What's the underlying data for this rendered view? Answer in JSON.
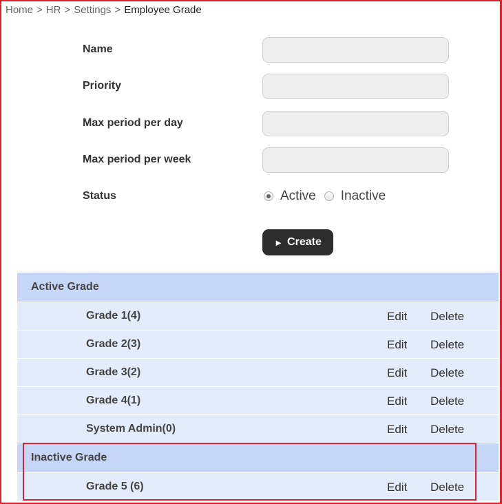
{
  "breadcrumb": {
    "items": [
      "Home",
      "HR",
      "Settings"
    ],
    "separator": ">",
    "current": "Employee Grade"
  },
  "form": {
    "name_label": "Name",
    "priority_label": "Priority",
    "max_day_label": "Max period per day",
    "max_week_label": "Max period per week",
    "status_label": "Status",
    "name_value": "",
    "priority_value": "",
    "max_day_value": "",
    "max_week_value": "",
    "status_options": [
      "Active",
      "Inactive"
    ],
    "status_selected": "Active",
    "create_label": "Create",
    "create_icon": "play-icon"
  },
  "active_grades": {
    "header": "Active Grade",
    "rows": [
      {
        "name": "Grade 1(4)",
        "edit": "Edit",
        "delete": "Delete"
      },
      {
        "name": "Grade 2(3)",
        "edit": "Edit",
        "delete": "Delete"
      },
      {
        "name": "Grade 3(2)",
        "edit": "Edit",
        "delete": "Delete"
      },
      {
        "name": "Grade 4(1)",
        "edit": "Edit",
        "delete": "Delete"
      },
      {
        "name": "System Admin(0)",
        "edit": "Edit",
        "delete": "Delete"
      }
    ]
  },
  "inactive_grades": {
    "header": "Inactive Grade",
    "rows": [
      {
        "name": "Grade 5 (6)",
        "edit": "Edit",
        "delete": "Delete"
      }
    ]
  },
  "colors": {
    "highlight": "#d9232d",
    "header_bg": "#c5d6f6",
    "row_bg": "#e2ecfb",
    "button_bg": "#2d2d2d"
  }
}
